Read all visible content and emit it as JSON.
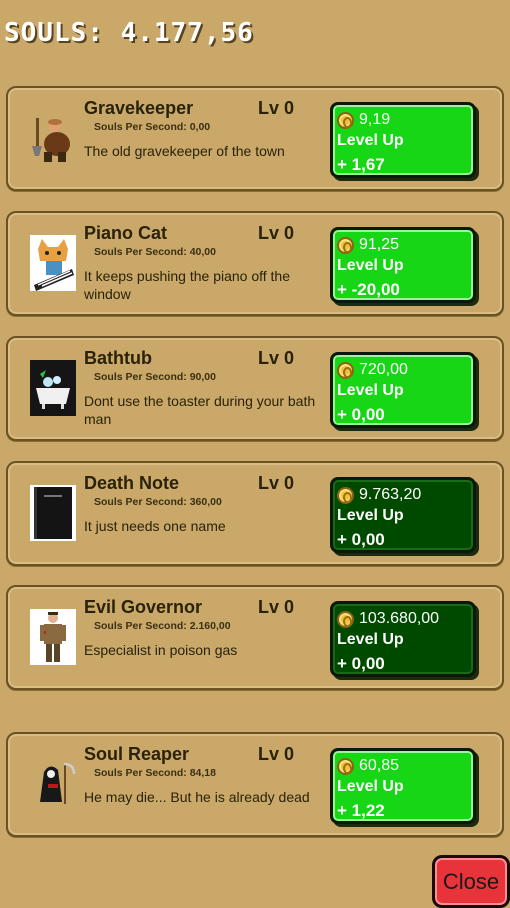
{
  "header": {
    "souls_text": "SOULS: 4.177,56"
  },
  "labels": {
    "level_up": "Level Up"
  },
  "items": [
    {
      "name": "Gravekeeper",
      "level": "Lv 0",
      "sps": "Souls Per Second: 0,00",
      "description": "The old gravekeeper of the town",
      "price": "9,19",
      "gain": "+ 1,67",
      "affordable": true,
      "icon": "gravekeeper-icon"
    },
    {
      "name": "Piano Cat",
      "level": "Lv 0",
      "sps": "Souls Per Second: 40,00",
      "description": "It keeps pushing the piano off the window",
      "price": "91,25",
      "gain": "+ -20,00",
      "affordable": true,
      "icon": "piano-cat-icon"
    },
    {
      "name": "Bathtub",
      "level": "Lv 0",
      "sps": "Souls Per Second: 90,00",
      "description": "Dont use the toaster during your bath man",
      "price": "720,00",
      "gain": "+ 0,00",
      "affordable": true,
      "icon": "bathtub-icon"
    },
    {
      "name": "Death Note",
      "level": "Lv 0",
      "sps": "Souls Per Second: 360,00",
      "description": "It just needs one name",
      "price": "9.763,20",
      "gain": "+ 0,00",
      "affordable": false,
      "icon": "death-note-icon"
    },
    {
      "name": "Evil Governor",
      "level": "Lv 0",
      "sps": "Souls Per Second: 2.160,00",
      "description": "Especialist in poison gas",
      "price": "103.680,00",
      "gain": "+ 0,00",
      "affordable": false,
      "icon": "evil-governor-icon"
    },
    {
      "name": "Soul Reaper",
      "level": "Lv 0",
      "sps": "Souls Per Second: 84,18",
      "description": "He may die... But he is already dead",
      "price": "60,85",
      "gain": "+ 1,22",
      "affordable": true,
      "icon": "soul-reaper-icon"
    }
  ],
  "close_button": {
    "label": "Close"
  },
  "colors": {
    "background": "#c9a86a",
    "button_active": "#16d616",
    "button_inactive": "#004a00",
    "close": "#e8333b"
  }
}
